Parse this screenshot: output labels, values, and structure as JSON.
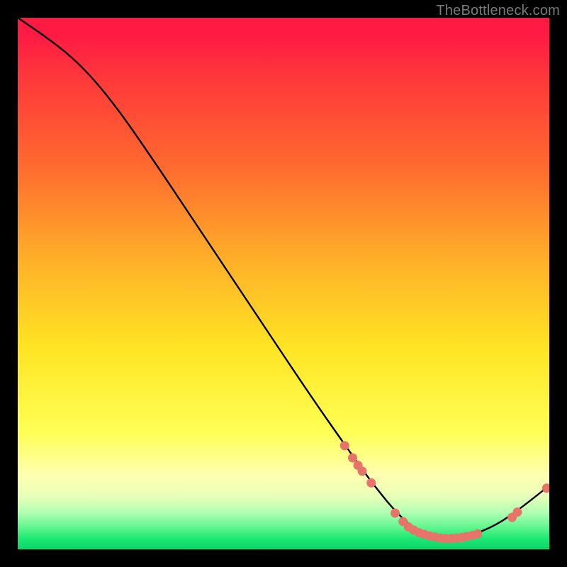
{
  "watermark": "TheBottleneck.com",
  "chart_data": {
    "type": "line",
    "title": "",
    "xlabel": "",
    "ylabel": "",
    "xlim": [
      0,
      100
    ],
    "ylim": [
      0,
      100
    ],
    "grid": false,
    "legend": false,
    "curve": [
      {
        "x": 0,
        "y": 100
      },
      {
        "x": 6,
        "y": 96
      },
      {
        "x": 12,
        "y": 91
      },
      {
        "x": 18,
        "y": 84
      },
      {
        "x": 25,
        "y": 74
      },
      {
        "x": 35,
        "y": 59
      },
      {
        "x": 45,
        "y": 44
      },
      {
        "x": 55,
        "y": 29
      },
      {
        "x": 62,
        "y": 19
      },
      {
        "x": 67,
        "y": 12
      },
      {
        "x": 72,
        "y": 6
      },
      {
        "x": 76,
        "y": 3
      },
      {
        "x": 80,
        "y": 2
      },
      {
        "x": 85,
        "y": 2.5
      },
      {
        "x": 90,
        "y": 4.5
      },
      {
        "x": 95,
        "y": 8
      },
      {
        "x": 100,
        "y": 12
      }
    ],
    "markers": [
      {
        "x": 61.5,
        "y": 19.5
      },
      {
        "x": 63.0,
        "y": 17.2
      },
      {
        "x": 64.0,
        "y": 15.8
      },
      {
        "x": 64.8,
        "y": 14.7
      },
      {
        "x": 66.5,
        "y": 12.5
      },
      {
        "x": 71.0,
        "y": 6.8
      },
      {
        "x": 72.5,
        "y": 5.2
      },
      {
        "x": 73.5,
        "y": 4.2
      },
      {
        "x": 74.5,
        "y": 3.6
      },
      {
        "x": 75.5,
        "y": 3.1
      },
      {
        "x": 76.5,
        "y": 2.8
      },
      {
        "x": 77.5,
        "y": 2.5
      },
      {
        "x": 78.5,
        "y": 2.3
      },
      {
        "x": 79.5,
        "y": 2.1
      },
      {
        "x": 80.5,
        "y": 2.0
      },
      {
        "x": 81.5,
        "y": 2.0
      },
      {
        "x": 82.5,
        "y": 2.1
      },
      {
        "x": 83.5,
        "y": 2.2
      },
      {
        "x": 84.5,
        "y": 2.4
      },
      {
        "x": 85.5,
        "y": 2.6
      },
      {
        "x": 86.5,
        "y": 2.9
      },
      {
        "x": 93.0,
        "y": 6.0
      },
      {
        "x": 94.0,
        "y": 7.0
      },
      {
        "x": 99.5,
        "y": 11.5
      }
    ],
    "marker_color": "#e6746b",
    "line_color": "#000000"
  }
}
